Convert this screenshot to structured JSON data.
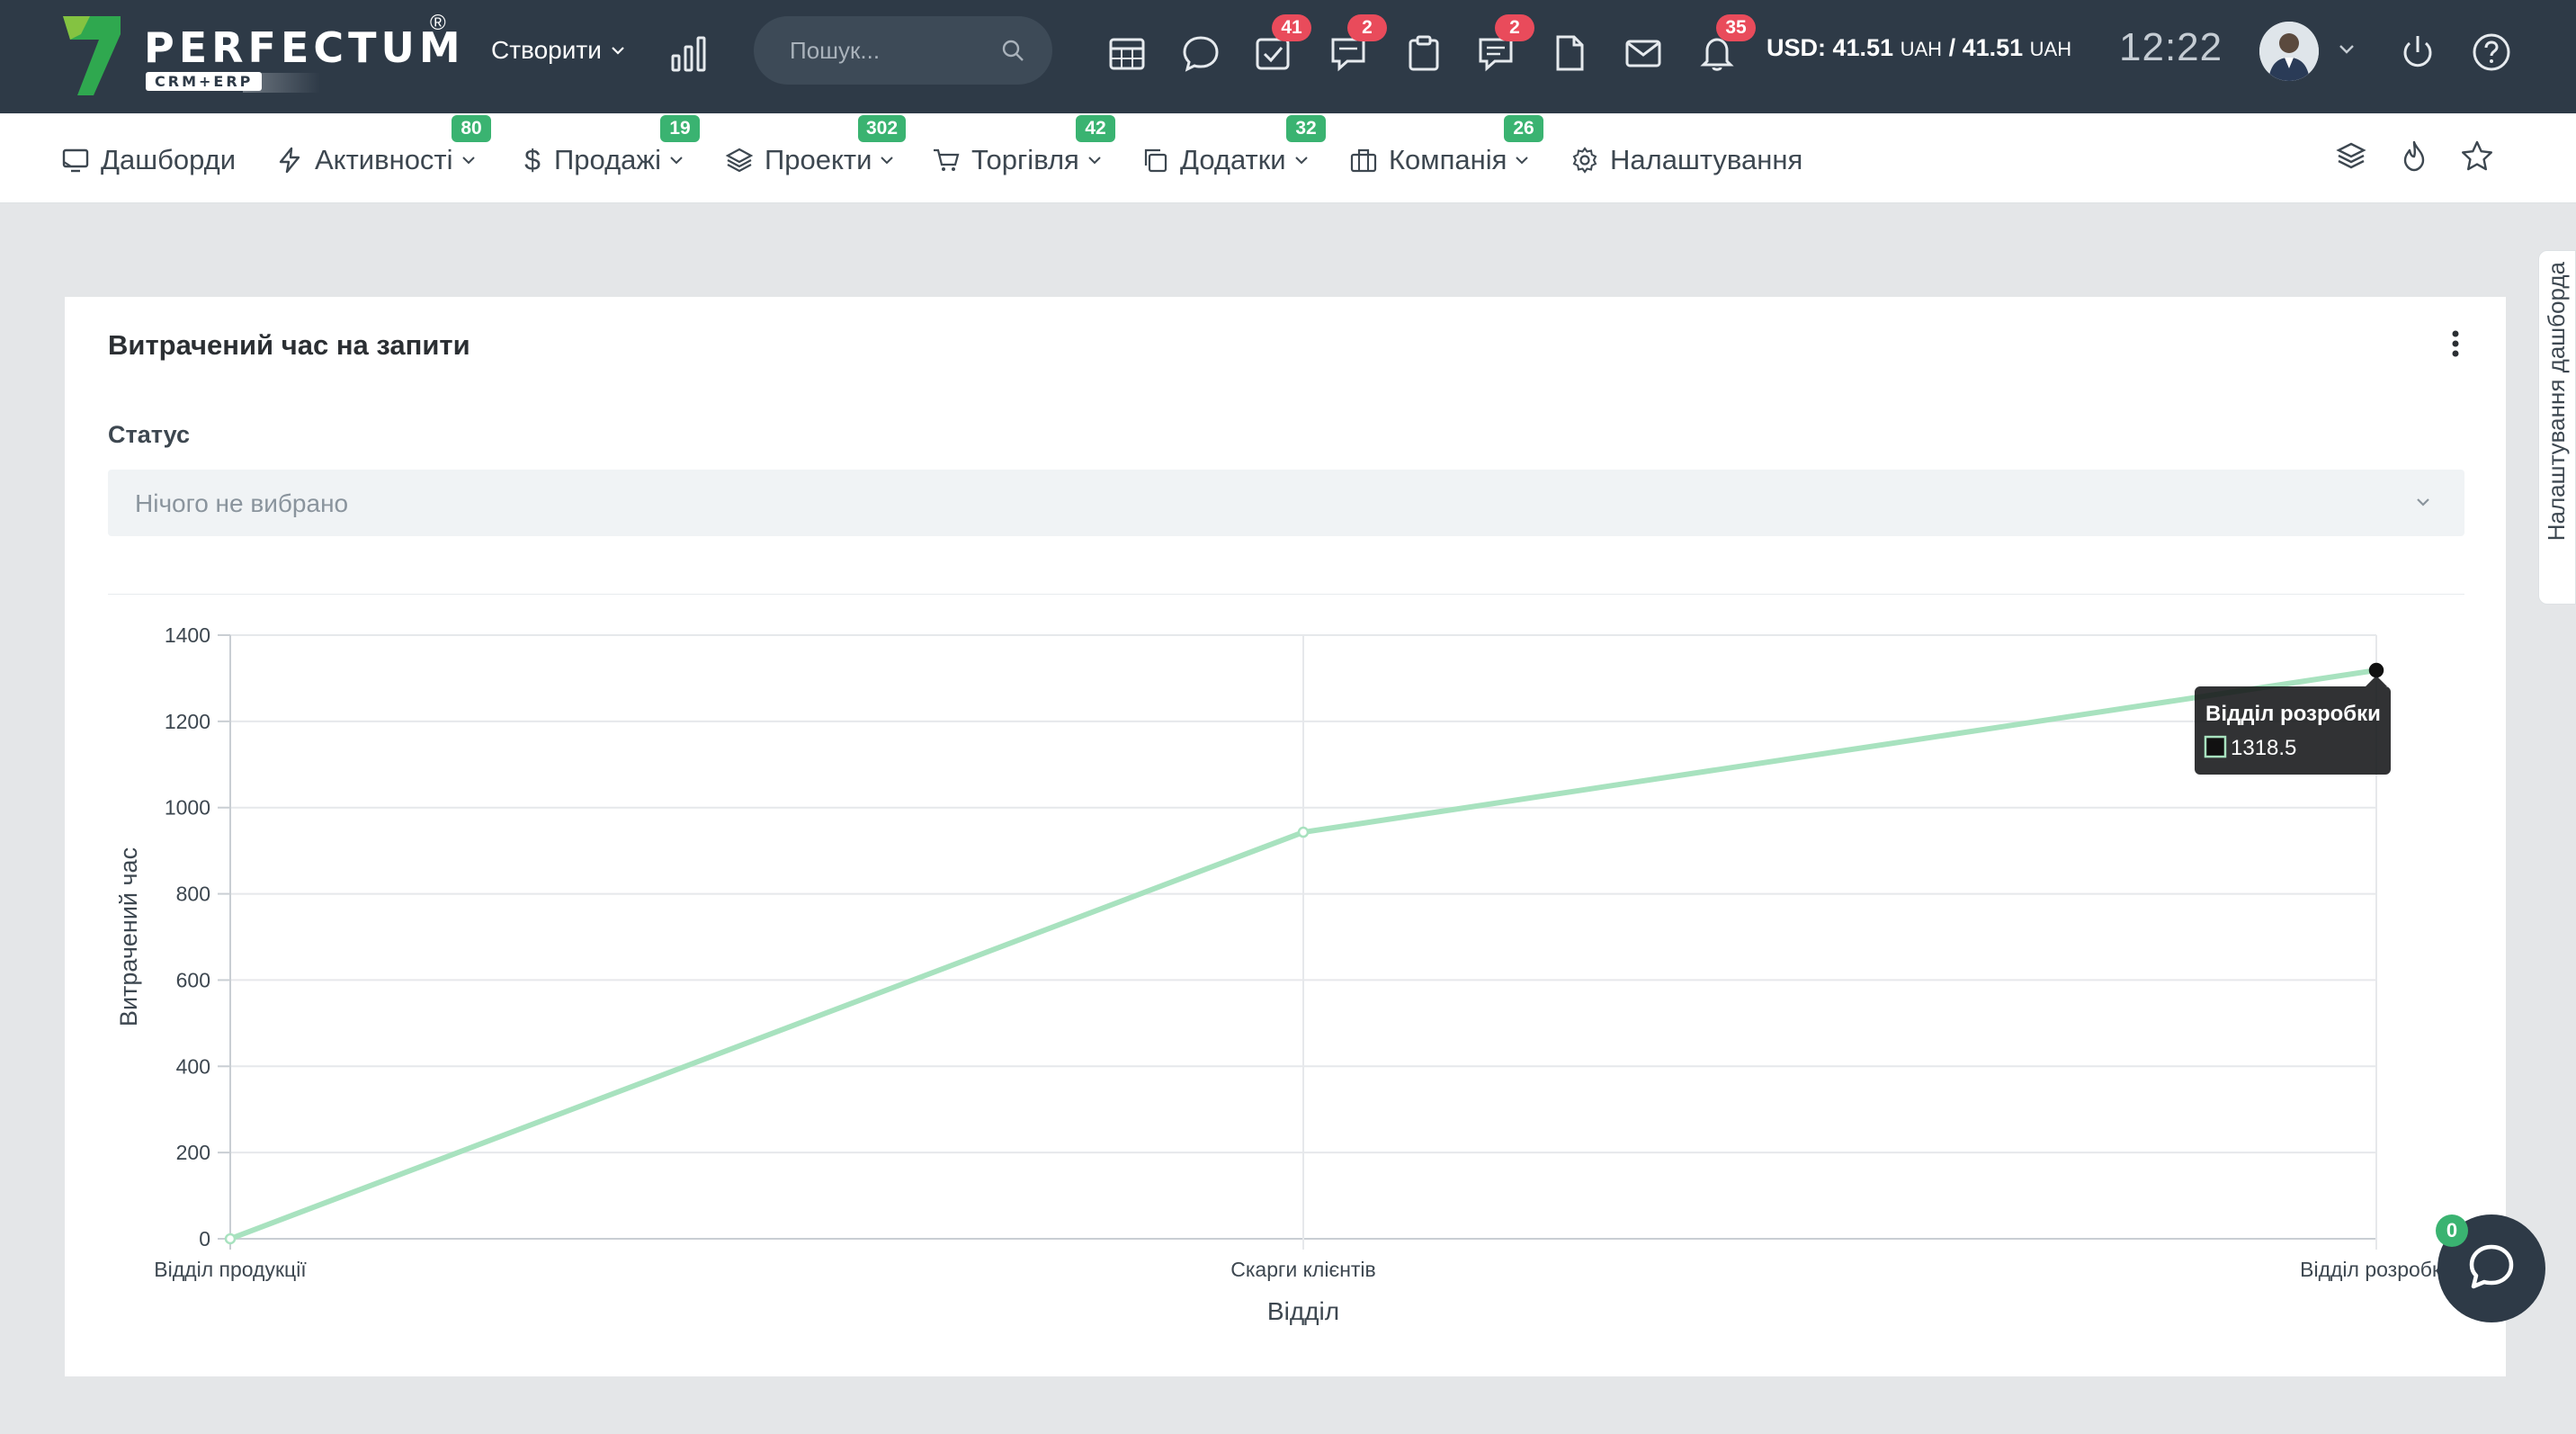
{
  "brand": {
    "name": "PERFECTUM",
    "registered": "®",
    "tagline": "CRM+ERP"
  },
  "header": {
    "create_label": "Створити",
    "search_placeholder": "Пошук...",
    "badges": {
      "tasks": "41",
      "discussions": "2",
      "comments": "2",
      "notifications": "35"
    },
    "currency_usd_label": "USD: 41.51",
    "currency_unit_1": "UAH",
    "currency_sep": "/ 41.51",
    "currency_unit_2": "UAH",
    "time": "12:22"
  },
  "nav": {
    "items": [
      {
        "label": "Дашборди",
        "badge": ""
      },
      {
        "label": "Активності",
        "badge": "80"
      },
      {
        "label": "Продажі",
        "badge": "19"
      },
      {
        "label": "Проекти",
        "badge": "302"
      },
      {
        "label": "Торгівля",
        "badge": "42"
      },
      {
        "label": "Додатки",
        "badge": "32"
      },
      {
        "label": "Компанія",
        "badge": "26"
      },
      {
        "label": "Налаштування",
        "badge": ""
      }
    ]
  },
  "side_tab": {
    "label": "Налаштування дашборда"
  },
  "card": {
    "title": "Витрачений час на запити",
    "status_label": "Статус",
    "status_value": "Нічого не вибрано"
  },
  "tooltip": {
    "title": "Відділ розробки",
    "value": "1318.5"
  },
  "chat": {
    "badge": "0"
  },
  "colors": {
    "topbar": "#2e3a47",
    "line": "#a8e2bf",
    "badge_red": "#e94b5b",
    "badge_green": "#3ab371"
  },
  "chart_data": {
    "type": "line",
    "categories": [
      "Відділ продукції",
      "Скарги клієнтів",
      "Відділ розробки"
    ],
    "series": [
      {
        "values": [
          0,
          943,
          1318.5
        ]
      }
    ],
    "xlabel": "Відділ",
    "ylabel": "Витрачений час",
    "ylim": [
      0,
      1400
    ],
    "yticks": [
      0,
      200,
      400,
      600,
      800,
      1000,
      1200,
      1400
    ],
    "grid": true,
    "legend": "none"
  }
}
